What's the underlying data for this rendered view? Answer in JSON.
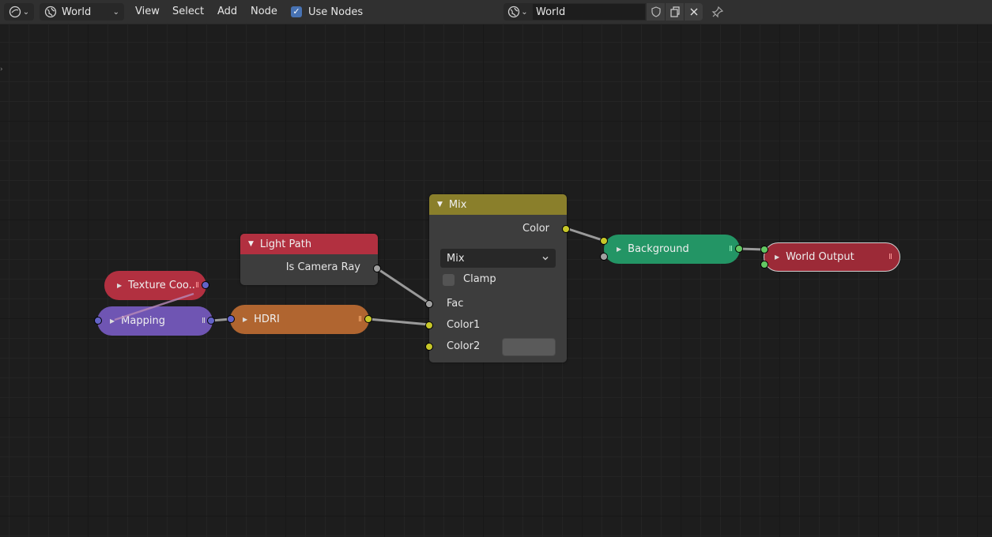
{
  "header": {
    "editor_type_icon": "node-editor-icon",
    "shader_type": {
      "label": "World",
      "icon": "world-icon"
    },
    "menus": [
      "View",
      "Select",
      "Add",
      "Node"
    ],
    "use_nodes": {
      "label": "Use Nodes",
      "checked": true
    },
    "world_block": {
      "name": "World",
      "icons": [
        "world-icon",
        "fake-user-shield-icon",
        "duplicate-icon",
        "unlink-x-icon"
      ]
    },
    "pin_icon": "pin-icon"
  },
  "nodes": {
    "texture_coordinate": {
      "title": "Texture Coo...",
      "color": "#b23040"
    },
    "mapping": {
      "title": "Mapping",
      "color": "#6f55b3"
    },
    "hdri": {
      "title": "HDRI",
      "color": "#b06530"
    },
    "light_path": {
      "title": "Light Path",
      "color": "#b23040",
      "output": "Is Camera Ray"
    },
    "mix": {
      "title": "Mix",
      "color": "#8a7f2b",
      "output": "Color",
      "blend_mode": "Mix",
      "clamp_label": "Clamp",
      "clamp_checked": false,
      "inputs": [
        "Fac",
        "Color1",
        "Color2"
      ],
      "color2_value": "#5a5a5a"
    },
    "background": {
      "title": "Background",
      "color": "#239565"
    },
    "world_output": {
      "title": "World Output",
      "color": "#9c2a37"
    }
  }
}
